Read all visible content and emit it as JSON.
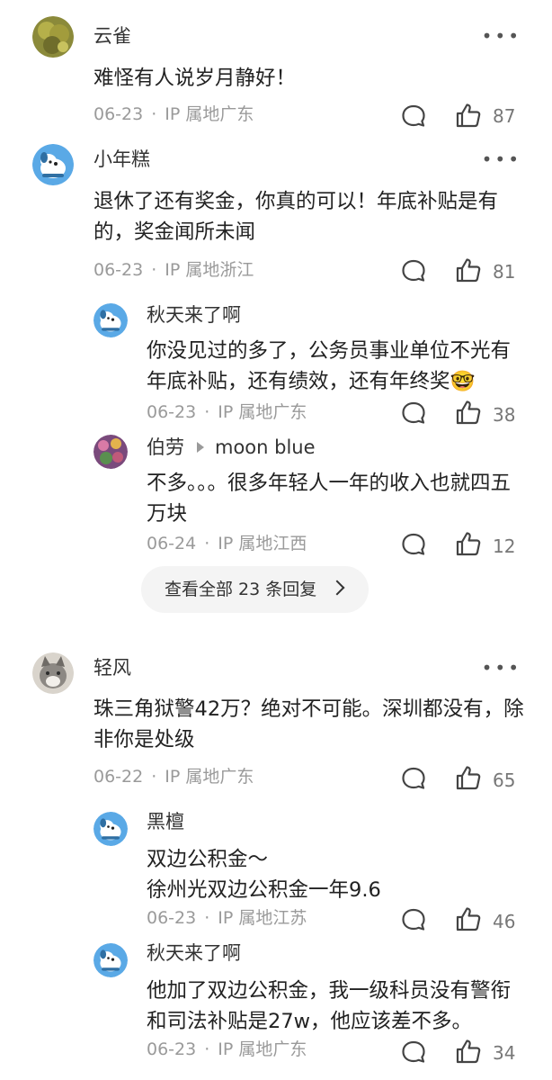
{
  "comments": [
    {
      "name": "云雀",
      "text": "难怪有人说岁月静好！",
      "date": "06-23",
      "ip": "IP 属地广东",
      "likes": "87"
    },
    {
      "name": "小年糕",
      "text": "退休了还有奖金，你真的可以！年底补贴是有的，奖金闻所未闻",
      "date": "06-23",
      "ip": "IP 属地浙江",
      "likes": "81",
      "replies": [
        {
          "name": "秋天来了啊",
          "text": "你没见过的多了，公务员事业单位不光有年底补贴，还有绩效，还有年终奖",
          "emoji": "🤓",
          "date": "06-23",
          "ip": "IP 属地广东",
          "likes": "38"
        },
        {
          "name": "伯劳",
          "reply_to": "moon blue",
          "text": "不多。。。很多年轻人一年的收入也就四五万块",
          "date": "06-24",
          "ip": "IP 属地江西",
          "likes": "12"
        }
      ],
      "view_all": "查看全部 23 条回复"
    },
    {
      "name": "轻风",
      "text": "珠三角狱警42万？绝对不可能。深圳都没有，除非你是处级",
      "date": "06-22",
      "ip": "IP 属地广东",
      "likes": "65",
      "replies": [
        {
          "name": "黑檀",
          "text_line1": "双边公积金～",
          "text_line2": "徐州光双边公积金一年9.6",
          "date": "06-23",
          "ip": "IP 属地江苏",
          "likes": "46"
        },
        {
          "name": "秋天来了啊",
          "text": "他加了双边公积金，我一级科员没有警衔和司法补贴是27w，他应该差不多。",
          "date": "06-23",
          "ip": "IP 属地广东",
          "likes": "34"
        }
      ]
    }
  ],
  "meta_separator": "·",
  "more_glyph": "•••",
  "icons": {
    "comment": "comment-bubble-icon",
    "like": "thumbs-up-icon",
    "more": "more-dots-icon"
  }
}
